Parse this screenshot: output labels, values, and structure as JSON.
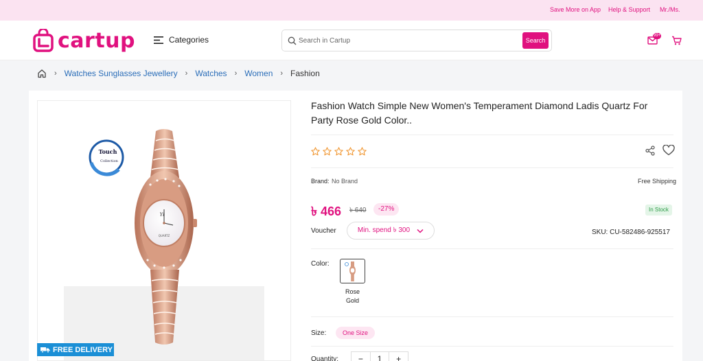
{
  "topbar": {
    "save_app": "Save More on App",
    "help": "Help & Support",
    "user": "Mr./Ms."
  },
  "header": {
    "logo_text": "cartup",
    "categories_label": "Categories",
    "search_placeholder": "Search in Cartup",
    "search_button": "Search",
    "message_badge": "99+"
  },
  "breadcrumb": {
    "items": [
      "Watches Sunglasses Jewellery",
      "Watches",
      "Women"
    ],
    "current": "Fashion"
  },
  "product": {
    "title": "Fashion Watch Simple New Women's Temperament Diamond Ladis Quartz For Party Rose Gold Color..",
    "rating_stars": 5,
    "brand_label": "Brand:",
    "brand_value": "No Brand",
    "shipping": "Free Shipping",
    "price": "৳ 466",
    "old_price": "৳ 640",
    "discount": "-27%",
    "stock": "In Stock",
    "voucher_label": "Voucher",
    "voucher_value": "Min. spend ৳ 300",
    "sku": "SKU: CU-582486-925517",
    "color_label": "Color:",
    "color_option": "Rose Gold",
    "size_label": "Size:",
    "size_option": "One Size",
    "quantity_label": "Quantity:",
    "quantity_minus": "−",
    "quantity_value": "1",
    "quantity_plus": "+"
  },
  "image": {
    "delivery_badge": "FREE DELIVERY",
    "brand_mark_line1": "Touch",
    "brand_mark_line2": "Collection"
  },
  "colors": {
    "brand_pink": "#e0117f",
    "link_blue": "#2a6db8",
    "delivery_blue": "#1b8fd6",
    "stock_green": "#2c9b47",
    "star_orange": "#f0932b"
  }
}
